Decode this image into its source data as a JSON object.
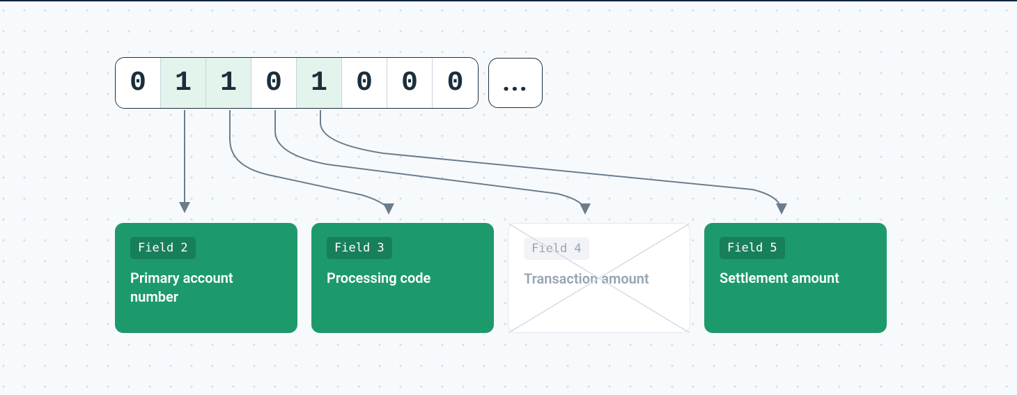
{
  "bitmap": {
    "bits": [
      "0",
      "1",
      "1",
      "0",
      "1",
      "0",
      "0",
      "0"
    ],
    "highlighted_indices": [
      1,
      2,
      4
    ],
    "ellipsis": "..."
  },
  "fields": [
    {
      "badge": "Field 2",
      "description": "Primary account number",
      "active": true
    },
    {
      "badge": "Field 3",
      "description": "Processing code",
      "active": true
    },
    {
      "badge": "Field 4",
      "description": "Transaction amount",
      "active": false
    },
    {
      "badge": "Field 5",
      "description": "Settlement amount",
      "active": true
    }
  ],
  "colors": {
    "active_card": "#1D9A6C",
    "highlight_bg": "#E3F4EC",
    "arrow": "#6B7C8C"
  }
}
